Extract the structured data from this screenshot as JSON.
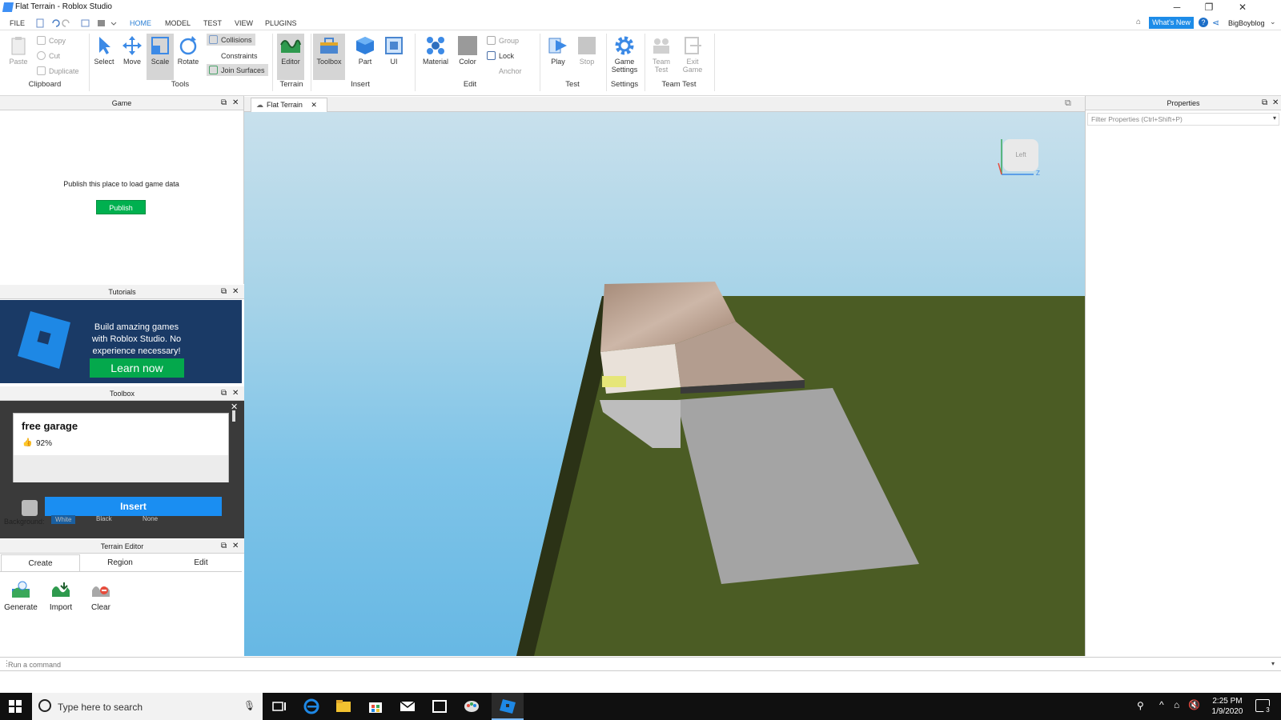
{
  "window": {
    "title": "Flat Terrain - Roblox Studio",
    "min": "─",
    "max": "❐",
    "close": "✕"
  },
  "menu": {
    "items": [
      "FILE",
      "HOME",
      "MODEL",
      "TEST",
      "VIEW",
      "PLUGINS"
    ],
    "active": "HOME",
    "whats_new": "What's New",
    "help": "?",
    "user": "BigBoyblog",
    "user_arrow": "⌄"
  },
  "ribbon": {
    "clipboard": {
      "paste": "Paste",
      "copy": "Copy",
      "cut": "Cut",
      "duplicate": "Duplicate",
      "group": "Clipboard"
    },
    "tools": {
      "select": "Select",
      "move": "Move",
      "scale": "Scale",
      "rotate": "Rotate",
      "collisions": "Collisions",
      "constraints": "Constraints",
      "join_surfaces": "Join Surfaces",
      "group": "Tools"
    },
    "terrain": {
      "editor": "Editor",
      "group": "Terrain"
    },
    "insert": {
      "toolbox": "Toolbox",
      "part": "Part",
      "ui": "UI",
      "group": "Insert"
    },
    "edit": {
      "material": "Material",
      "color": "Color",
      "group_btn": "Group",
      "lock": "Lock",
      "anchor": "Anchor",
      "group": "Edit"
    },
    "test": {
      "play": "Play",
      "stop": "Stop",
      "group": "Test"
    },
    "settings": {
      "game_settings_1": "Game",
      "game_settings_2": "Settings",
      "group": "Settings"
    },
    "team_test": {
      "team_test_1": "Team",
      "team_test_2": "Test",
      "exit_game_1": "Exit",
      "exit_game_2": "Game",
      "group": "Team Test"
    }
  },
  "game_panel": {
    "title": "Game",
    "message": "Publish this place to load game data",
    "publish": "Publish"
  },
  "tutorials_panel": {
    "title": "Tutorials",
    "text": "Build amazing games with Roblox Studio. No experience necessary!",
    "learn": "Learn now"
  },
  "toolbox_panel": {
    "title": "Toolbox",
    "card_title": "free garage",
    "rating": "92%",
    "insert": "Insert",
    "background_label": "Background:",
    "bg_options": [
      "White",
      "Black",
      "None"
    ]
  },
  "terrain_editor": {
    "title": "Terrain Editor",
    "tabs": [
      "Create",
      "Region",
      "Edit"
    ],
    "tools": [
      "Generate",
      "Import",
      "Clear"
    ]
  },
  "viewport": {
    "tab": "Flat Terrain",
    "view_cube_label": "Left",
    "axis_z": "Z"
  },
  "properties_panel": {
    "title": "Properties",
    "filter_placeholder": "Filter Properties (Ctrl+Shift+P)"
  },
  "command_bar": {
    "placeholder": "Run a command"
  },
  "taskbar": {
    "search_placeholder": "Type here to search",
    "time": "2:25 PM",
    "date": "1/9/2020",
    "notifications": "3"
  },
  "colors": {
    "accent": "#1d8ce8",
    "publish_green": "#00b04f",
    "grass": "#4b5c24",
    "sky": "#8fc8e0"
  }
}
